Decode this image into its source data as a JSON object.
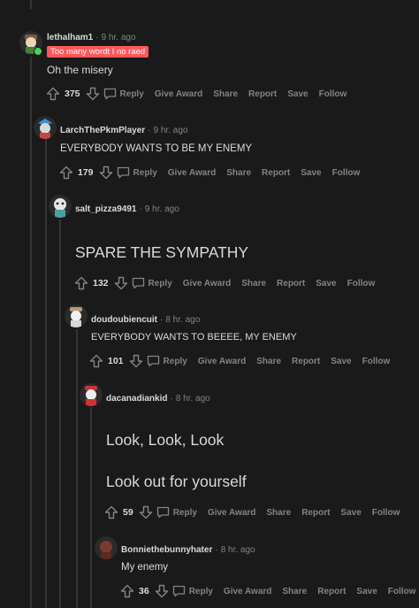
{
  "comments": [
    {
      "author": "lethalham1",
      "time": "9 hr. ago",
      "flair": "Too many wordt I no raed",
      "body": [
        "Oh the misery"
      ],
      "score": "375"
    },
    {
      "author": "LarchThePkmPlayer",
      "time": "9 hr. ago",
      "body": [
        "EVERYBODY WANTS TO BE MY ENEMY"
      ],
      "score": "179"
    },
    {
      "author": "salt_pizza9491",
      "time": "9 hr. ago",
      "body": [
        "SPARE THE SYMPATHY"
      ],
      "score": "132"
    },
    {
      "author": "doudoubiencuit",
      "time": "8 hr. ago",
      "body": [
        "EVERYBODY WANTS TO BEEEE, MY ENEMY"
      ],
      "score": "101"
    },
    {
      "author": "dacanadiankid",
      "time": "8 hr. ago",
      "body": [
        "Look, Look, Look",
        "Look out for yourself"
      ],
      "score": "59"
    },
    {
      "author": "Bonniethebunnyhater",
      "time": "8 hr. ago",
      "body": [
        "My enemy"
      ],
      "score": "36"
    }
  ],
  "actions": {
    "reply": "Reply",
    "give_award": "Give Award",
    "share": "Share",
    "report": "Report",
    "save": "Save",
    "follow": "Follow"
  },
  "separator": "·",
  "colors": {
    "background": "#1a1a1b",
    "text": "#d7dadc",
    "muted": "#818384",
    "flair": "#ff585b",
    "thread_line": "#343536"
  },
  "icons": [
    "upvote-icon",
    "downvote-icon",
    "reply-bubble-icon",
    "avatar"
  ]
}
